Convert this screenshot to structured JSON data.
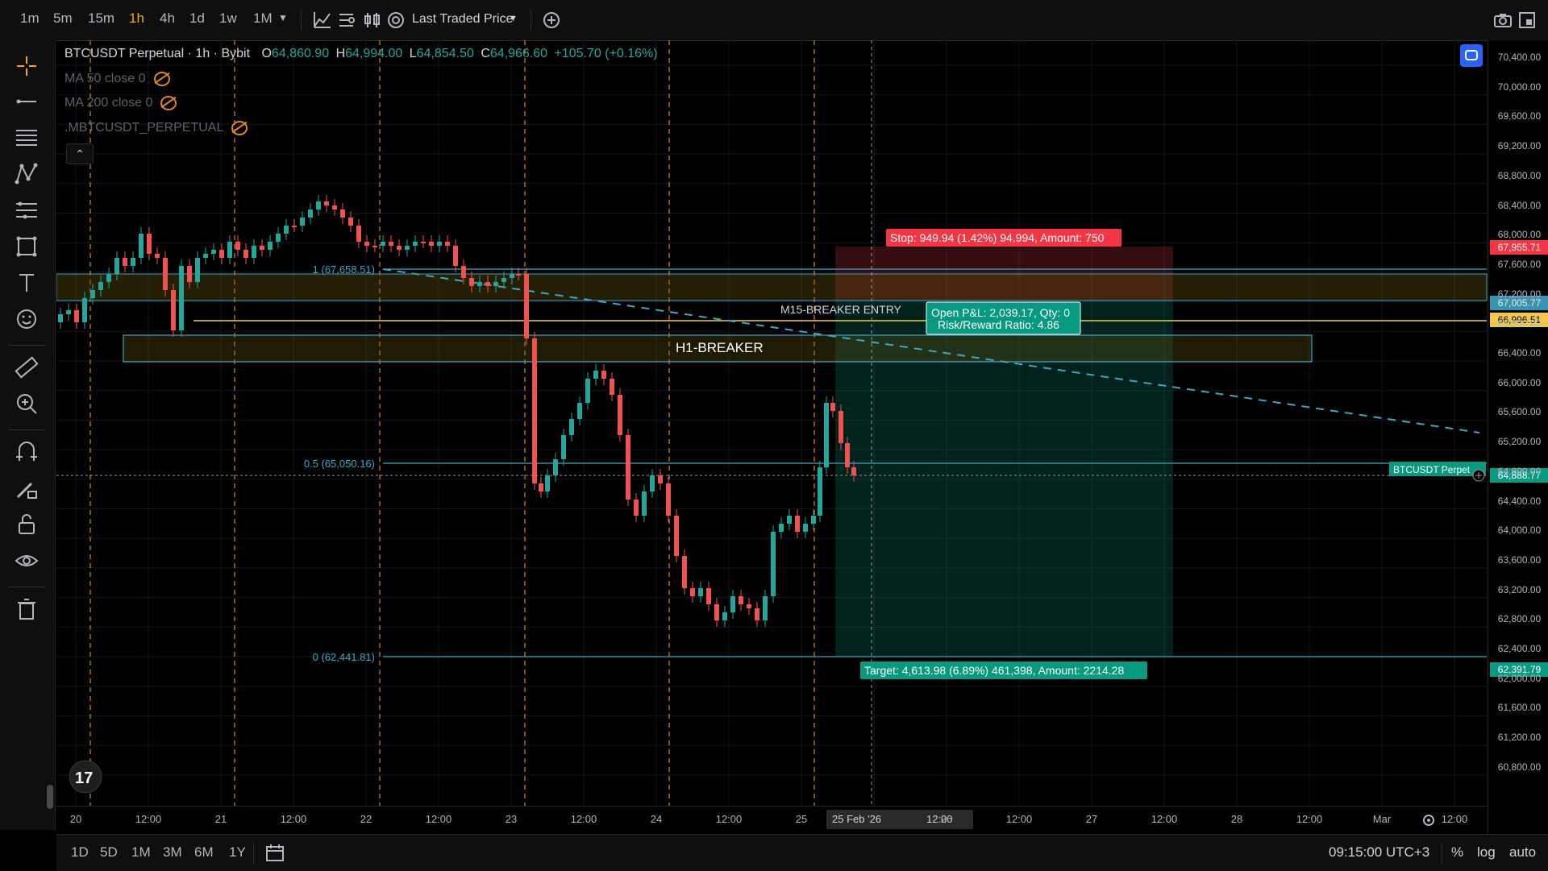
{
  "toolbar": {
    "timeframes": [
      "1m",
      "5m",
      "15m",
      "1h",
      "4h",
      "1d",
      "1w",
      "1M"
    ],
    "active_timeframe": "1h",
    "price_source": "Last Traded Price"
  },
  "legend": {
    "symbol": "BTCUSDT Perpetual · 1h · Bybit",
    "o_label": "O",
    "o": "64,860.90",
    "h_label": "H",
    "h": "64,994.00",
    "l_label": "L",
    "l": "64,854.50",
    "c_label": "C",
    "c": "64,966.60",
    "change": "+105.70 (+0.16%)"
  },
  "indicators": [
    "MA 50 close 0",
    "MA 200 close 0",
    ".MBTCUSDT_PERPETUAL"
  ],
  "fib_labels": {
    "level1": "1 (67,658.51)",
    "level05": "0.5 (65,050.16)",
    "level0": "0 (62,441.81)"
  },
  "annotations": {
    "m15_entry": "M15-BREAKER ENTRY",
    "h1_breaker": "H1-BREAKER",
    "stop": "Stop: 949.94 (1.42%) 94,994, Amount: 750",
    "pnl_line1": "Open P&L: 2,039.17, Qty: 0",
    "pnl_line2": "Risk/Reward Ratio: 4.86",
    "target": "Target: 4,613.98 (6.89%) 461,398, Amount: 2214.28",
    "symbol_tag": "BTCUSDT Perpet"
  },
  "price_axis": {
    "ticks": [
      "70,400.00",
      "70,000.00",
      "69,600.00",
      "69,200.00",
      "68,800.00",
      "68,400.00",
      "68,000.00",
      "67,600.00",
      "67,200.00",
      "66,800.00",
      "66,400.00",
      "66,000.00",
      "65,600.00",
      "65,200.00",
      "64,800.00",
      "64,400.00",
      "64,000.00",
      "63,600.00",
      "63,200.00",
      "62,800.00",
      "62,400.00",
      "62,000.00",
      "61,600.00",
      "61,200.00",
      "60,800.00"
    ],
    "stop_price": "67,955.71",
    "entry_high": "67,005.77",
    "entry_price": "66,996.51",
    "current_price": "64,888.77",
    "target_price": "62,391.79"
  },
  "time_axis": {
    "labels": [
      "20",
      "12:00",
      "21",
      "12:00",
      "22",
      "12:00",
      "23",
      "12:00",
      "24",
      "12:00",
      "25",
      "12:00",
      "26",
      "12:00",
      "27",
      "12:00",
      "28",
      "12:00",
      "Mar",
      "12:00"
    ],
    "crosshair": "25 Feb '26"
  },
  "bottom": {
    "ranges": [
      "1D",
      "5D",
      "1M",
      "3M",
      "6M",
      "1Y"
    ],
    "clock": "09:15:00 UTC+3",
    "pct": "%",
    "log": "log",
    "auto": "auto"
  },
  "colors": {
    "up": "#26a69a",
    "down": "#ef5350",
    "orange": "#f5a623",
    "fib": "#3fa6c4",
    "stop_red": "#f23645",
    "target_teal": "#089981"
  }
}
